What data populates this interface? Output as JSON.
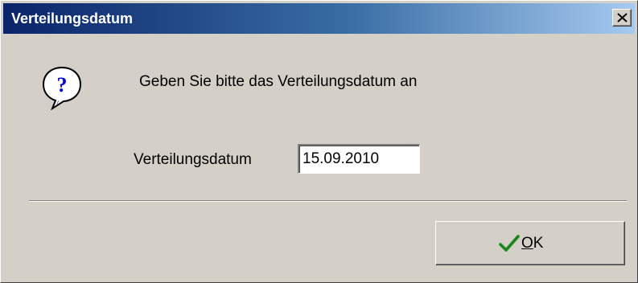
{
  "window": {
    "title": "Verteilungsdatum"
  },
  "icons": {
    "close": "close-icon",
    "question": "question-icon",
    "check": "checkmark-icon"
  },
  "dialog": {
    "message": "Geben Sie bitte das Verteilungsdatum an",
    "field_label": "Verteilungsdatum",
    "date_value": "15.09.2010"
  },
  "buttons": {
    "ok_mnemonic": "O",
    "ok_rest": "K"
  },
  "colors": {
    "titlebar_start": "#0a246a",
    "titlebar_end": "#a6caf0",
    "window_bg": "#d4d0c8",
    "check_green": "#2e9a2e"
  }
}
